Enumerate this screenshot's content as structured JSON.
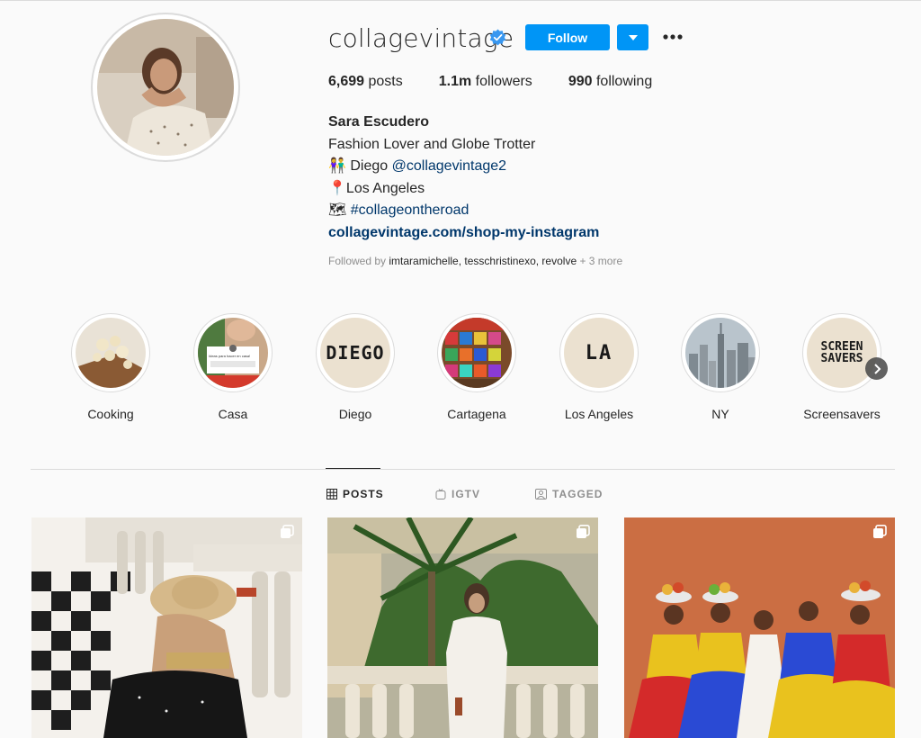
{
  "profile": {
    "username": "collagevintage",
    "follow_label": "Follow",
    "stats": {
      "posts_count": "6,699",
      "posts_label": "posts",
      "followers_count": "1.1m",
      "followers_label": "followers",
      "following_count": "990",
      "following_label": "following"
    },
    "bio": {
      "name": "Sara Escudero",
      "line1": "Fashion Lover and Globe Trotter",
      "line2_prefix": "👫 Diego ",
      "line2_mention": "@collagevintage2",
      "line3": "📍Los Angeles",
      "line4_prefix": "🗺 ",
      "line4_hashtag": "#collageontheroad",
      "website": "collagevintage.com/shop-my-instagram"
    },
    "followed_by": {
      "prefix": "Followed by ",
      "names": "imtaramichelle, tesschristinexo, revolve",
      "more": " + 3 more"
    }
  },
  "highlights": [
    {
      "label": "Cooking"
    },
    {
      "label": "Casa",
      "card_text": "Ideas para hacer en casa!"
    },
    {
      "label": "Diego",
      "cover_text": "DIEGO"
    },
    {
      "label": "Cartagena"
    },
    {
      "label": "Los Angeles",
      "cover_text": "LA"
    },
    {
      "label": "NY"
    },
    {
      "label": "Screensavers",
      "cover_line1": "SCREEN",
      "cover_line2": "SAVERS"
    }
  ],
  "tabs": [
    {
      "label": "POSTS",
      "icon": "grid-icon",
      "active": true
    },
    {
      "label": "IGTV",
      "icon": "igtv-icon",
      "active": false
    },
    {
      "label": "TAGGED",
      "icon": "tag-icon",
      "active": false
    }
  ],
  "colors": {
    "accent": "#0095f6",
    "link": "#00376b",
    "verified": "#3897f0"
  }
}
